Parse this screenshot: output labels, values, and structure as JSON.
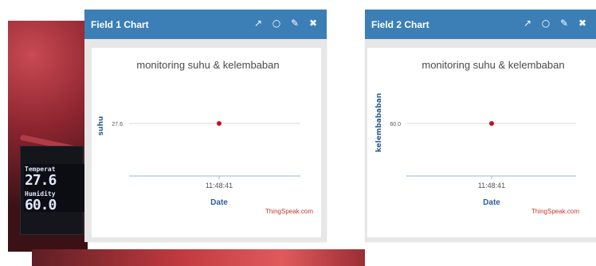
{
  "colors": {
    "header": "#3b7fb6",
    "point": "#c1121f",
    "gridline": "#d8d8d8",
    "axis": "#9bbad0",
    "axis_text": "#2f5f95",
    "credit": "#c0392b"
  },
  "oled": {
    "label_temp": "Temperat",
    "value_temp": "27.6",
    "label_hum": "Humidity",
    "value_hum": "60.0"
  },
  "panels": [
    {
      "header_title": "Field 1 Chart",
      "tools": [
        "external-link-icon",
        "comment-icon",
        "pencil-icon",
        "close-icon"
      ],
      "chart_data": {
        "type": "line",
        "title": "monitoring suhu & kelembaban",
        "xlabel": "Date",
        "ylabel": "suhu",
        "x": [
          "11:48:41"
        ],
        "series": [
          {
            "values": [
              27.6
            ]
          }
        ],
        "yticks": [
          "27.6"
        ],
        "credit": "ThingSpeak.com",
        "grid": true
      }
    },
    {
      "header_title": "Field 2 Chart",
      "tools": [
        "external-link-icon",
        "comment-icon",
        "pencil-icon",
        "close-icon"
      ],
      "chart_data": {
        "type": "line",
        "title": "monitoring suhu & kelembaban",
        "xlabel": "Date",
        "ylabel": "kelembababan",
        "x": [
          "11:48:41"
        ],
        "series": [
          {
            "values": [
              60.0
            ]
          }
        ],
        "yticks": [
          "60.0"
        ],
        "credit": "ThingSpeak.com",
        "grid": true
      }
    }
  ]
}
